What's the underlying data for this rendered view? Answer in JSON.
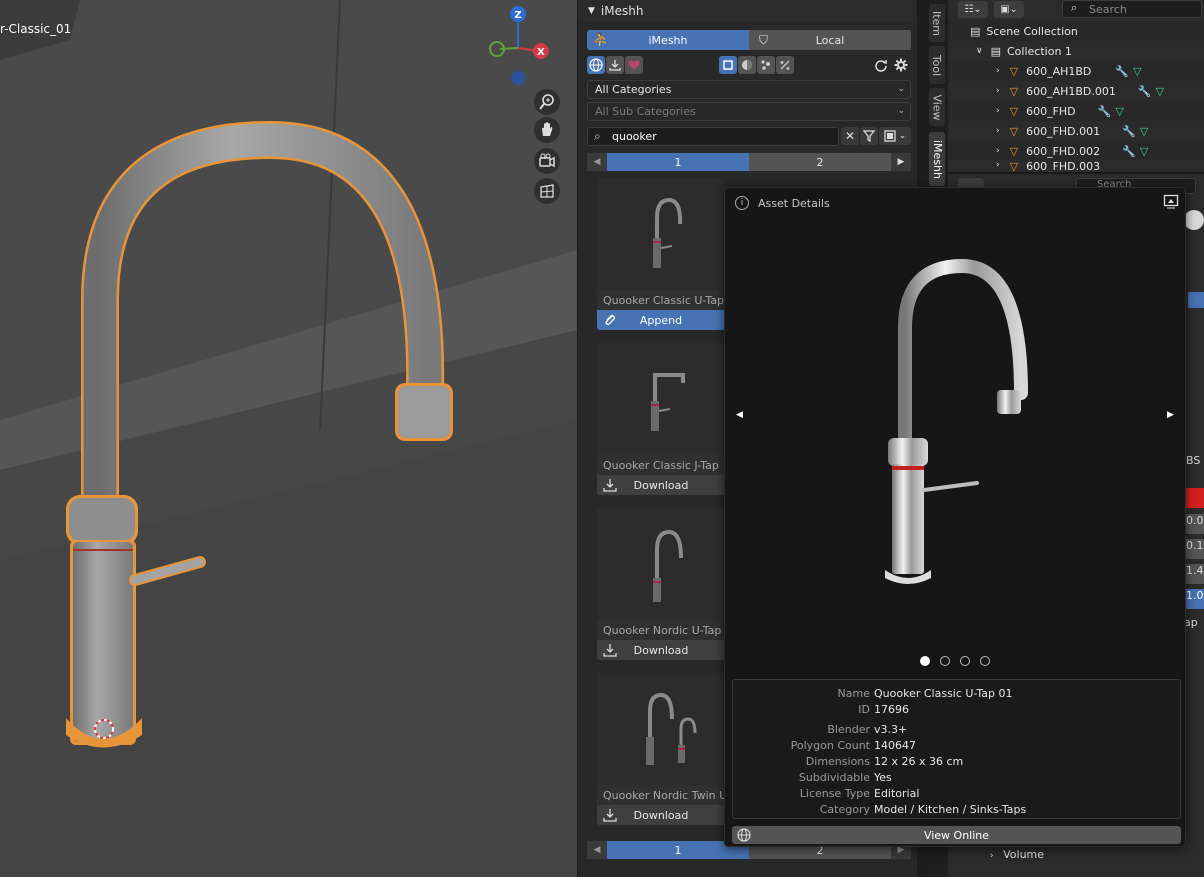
{
  "viewport": {
    "object_name": "r-Classic_01",
    "gizmo": {
      "z": "Z",
      "x": "X"
    }
  },
  "imeshh": {
    "title": "iMeshh",
    "tabs": [
      {
        "label": "iMeshh",
        "active": true
      },
      {
        "label": "Local",
        "active": false
      }
    ],
    "category": "All Categories",
    "sub_category": "All Sub Categories",
    "search_value": "quooker",
    "pages": [
      "1",
      "2"
    ],
    "assets": [
      {
        "title": "Quooker Classic U-Tap",
        "action": "Append"
      },
      {
        "title": "Quooker Classic J-Tap",
        "action": "Download"
      },
      {
        "title": "Quooker Nordic U-Tap",
        "action": "Download"
      },
      {
        "title": "Quooker Nordic Twin U",
        "action": "Download"
      }
    ],
    "side_tabs": [
      "Item",
      "Tool",
      "View",
      "iMeshh"
    ]
  },
  "outliner": {
    "search_placeholder": "Search",
    "scene_collection": "Scene Collection",
    "collection": "Collection 1",
    "items": [
      "600_AH1BD",
      "600_AH1BD.001",
      "600_FHD",
      "600_FHD.001",
      "600_FHD.002",
      "600_FHD.003"
    ]
  },
  "properties": {
    "search_placeholder": "Search",
    "fragments": [
      "BS",
      "0.0",
      "0.1",
      "1.4",
      "1.0",
      "ap"
    ],
    "volume_label": "Volume"
  },
  "asset_details": {
    "title": "Asset Details",
    "carousel_count": 4,
    "carousel_active": 0,
    "fields": [
      {
        "key": "Name",
        "value": "Quooker Classic U-Tap 01"
      },
      {
        "key": "ID",
        "value": "17696"
      },
      {
        "key": "Blender",
        "value": "v3.3+"
      },
      {
        "key": "Polygon Count",
        "value": "140647"
      },
      {
        "key": "Dimensions",
        "value": "12 x 26 x 36 cm"
      },
      {
        "key": "Subdividable",
        "value": "Yes"
      },
      {
        "key": "License Type",
        "value": "Editorial"
      },
      {
        "key": "Category",
        "value": "Model / Kitchen / Sinks-Taps"
      }
    ],
    "view_online_label": "View Online"
  },
  "colors": {
    "accent": "#4772b3",
    "selection_outline": "#e8953a"
  }
}
